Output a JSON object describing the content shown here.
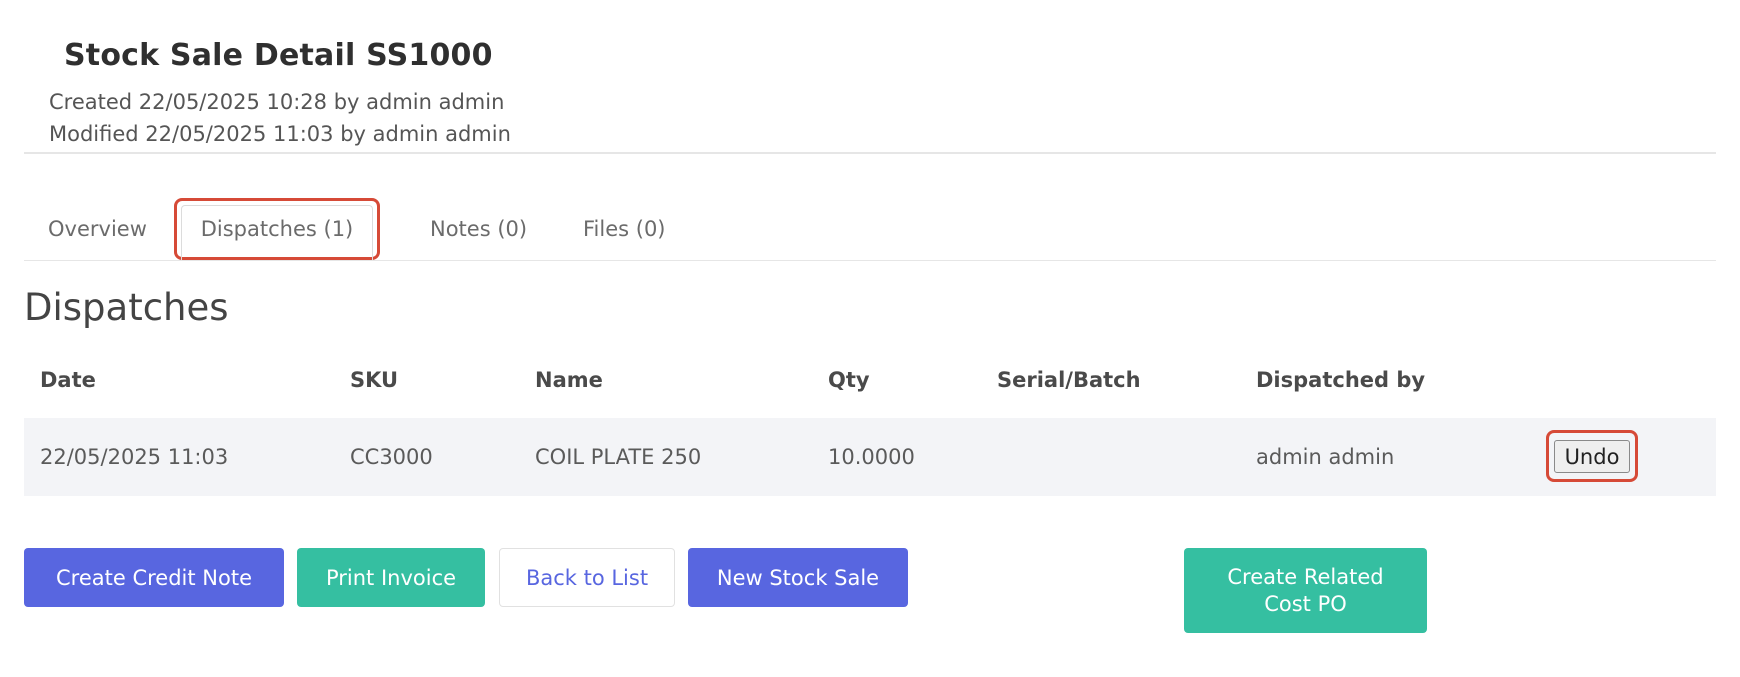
{
  "header": {
    "title": "Stock Sale Detail SS1000",
    "created": "Created 22/05/2025 10:28 by admin admin",
    "modified": "Modified 22/05/2025 11:03 by admin admin"
  },
  "tabs": [
    {
      "label": "Overview",
      "active": false
    },
    {
      "label": "Dispatches (1)",
      "active": true
    },
    {
      "label": "Notes (0)",
      "active": false
    },
    {
      "label": "Files (0)",
      "active": false
    }
  ],
  "section": {
    "title": "Dispatches"
  },
  "table": {
    "columns": [
      "Date",
      "SKU",
      "Name",
      "Qty",
      "Serial/Batch",
      "Dispatched by"
    ],
    "rows": [
      {
        "date": "22/05/2025 11:03",
        "sku": "CC3000",
        "name": "COIL PLATE 250",
        "qty": "10.0000",
        "serial": "",
        "dispatched_by": "admin admin",
        "action_label": "Undo"
      }
    ]
  },
  "actions": {
    "create_credit_note": "Create Credit Note",
    "print_invoice": "Print Invoice",
    "back_to_list": "Back to List",
    "new_stock_sale": "New Stock Sale",
    "create_related_cost_po": "Create Related Cost PO"
  },
  "colors": {
    "primary": "#5866e0",
    "success": "#35bfa1",
    "highlight": "#d64a37",
    "row_background": "#f3f4f7"
  }
}
